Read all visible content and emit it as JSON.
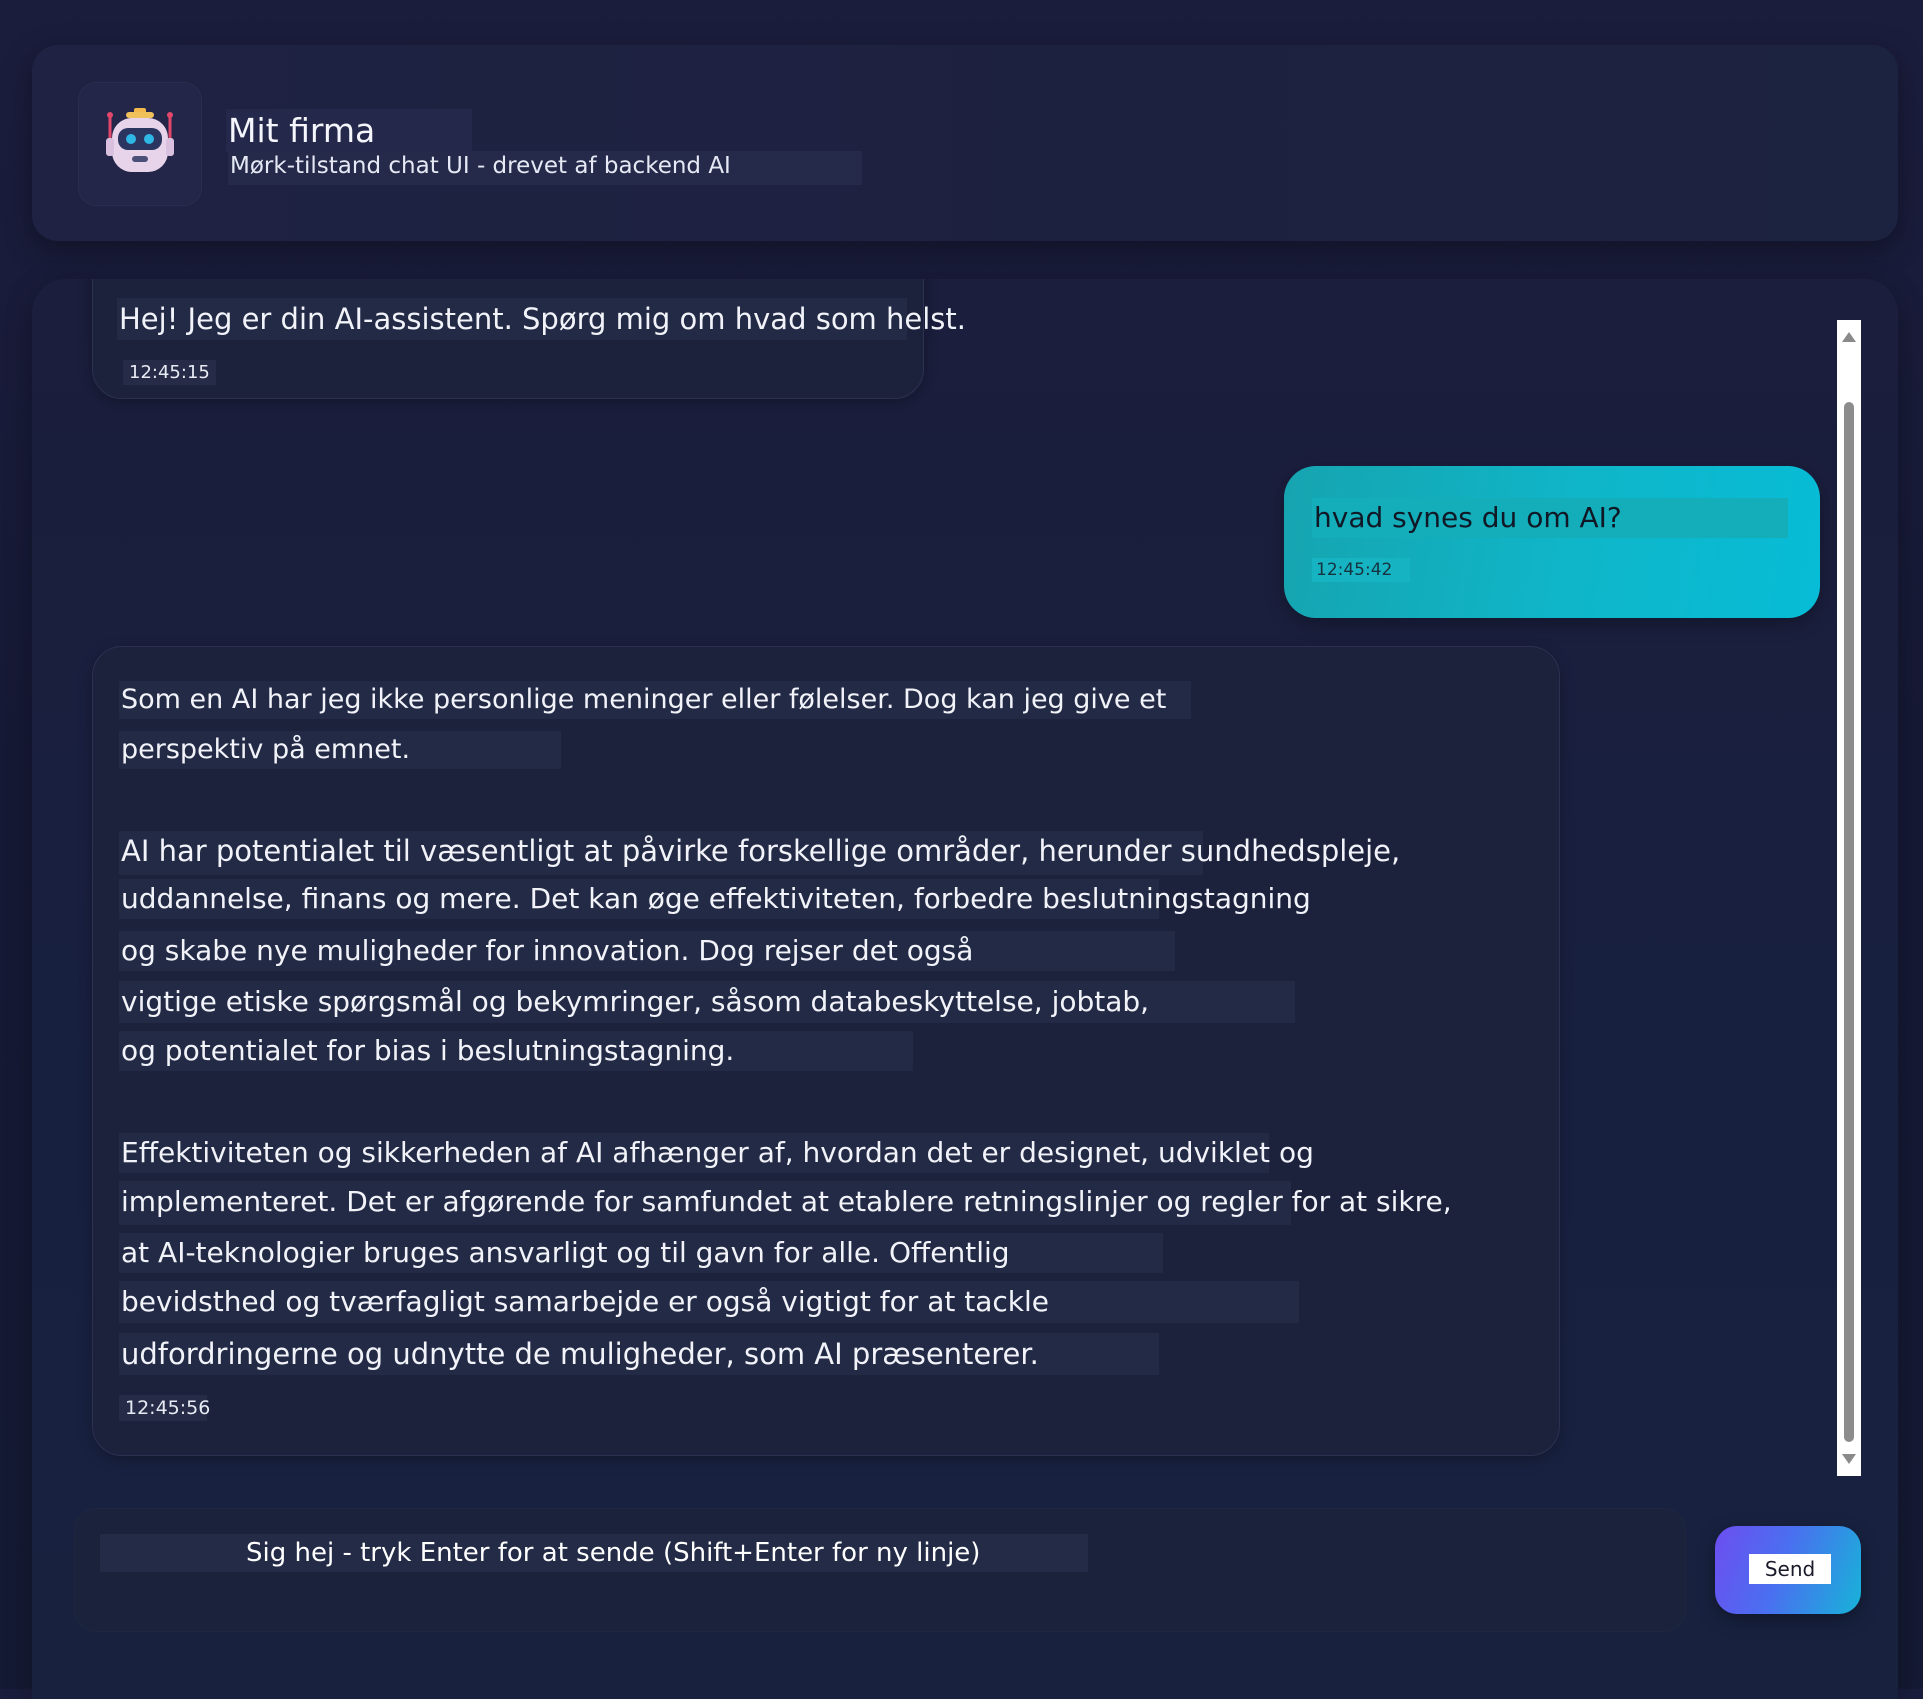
{
  "header": {
    "title": "Mit firma",
    "subtitle": "Mørk-tilstand chat UI - drevet af backend AI",
    "logo_icon": "robot-icon"
  },
  "messages": [
    {
      "role": "assistant",
      "lines": [
        "Hej! Jeg er din AI-assistent. Spørg mig om hvad som helst."
      ],
      "time": "12:45:15"
    },
    {
      "role": "user",
      "lines": [
        "hvad synes du om AI?"
      ],
      "time": "12:45:42"
    },
    {
      "role": "assistant",
      "lines": [
        "Som en AI har jeg ikke personlige meninger eller følelser. Dog kan jeg give et",
        "perspektiv på emnet.",
        "AI har potentialet til væsentligt at påvirke forskellige områder, herunder sundhedspleje,",
        "uddannelse, finans og mere. Det kan øge effektiviteten, forbedre beslutningstagning",
        "og skabe nye muligheder for innovation. Dog rejser det også",
        "vigtige etiske spørgsmål og bekymringer, såsom databeskyttelse, jobtab,",
        "og potentialet for bias i beslutningstagning.",
        "Effektiviteten og sikkerheden af AI afhænger af, hvordan det er designet, udviklet og",
        "implementeret. Det er afgørende for samfundet at etablere retningslinjer og regler for at sikre,",
        "at AI-teknologier bruges ansvarligt og til gavn for alle. Offentlig",
        "bevidsthed og tværfagligt samarbejde er også vigtigt for at tackle",
        "udfordringerne og udnytte de muligheder, som AI præsenterer."
      ],
      "time": "12:45:56"
    }
  ],
  "composer": {
    "placeholder": "Sig hej - tryk Enter for at sende (Shift+Enter for ny linje)",
    "value": "",
    "send_label": "Send"
  },
  "colors": {
    "background": "#171a38",
    "panel": "#1d2140",
    "user_bubble": "#0fb6c9",
    "assistant_bubble": "#1c213c",
    "send_gradient_start": "#6d4ef0",
    "send_gradient_end": "#17b3d8"
  }
}
